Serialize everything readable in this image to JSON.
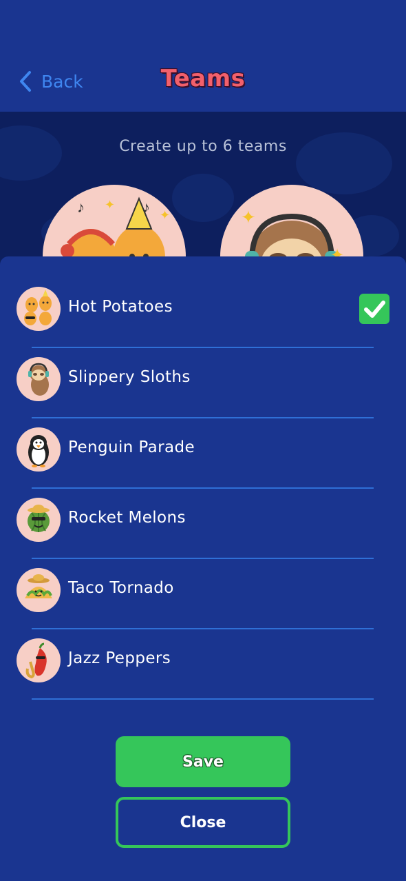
{
  "header": {
    "back_label": "Back",
    "title": "Teams"
  },
  "hero": {
    "subtitle": "Create up to 6 teams"
  },
  "teams": [
    {
      "name": "Hot Potatoes",
      "icon": "potato-icon",
      "selected": true
    },
    {
      "name": "Slippery Sloths",
      "icon": "sloth-icon",
      "selected": false
    },
    {
      "name": "Penguin Parade",
      "icon": "penguin-icon",
      "selected": false
    },
    {
      "name": "Rocket Melons",
      "icon": "melon-icon",
      "selected": false
    },
    {
      "name": "Taco Tornado",
      "icon": "taco-icon",
      "selected": false
    },
    {
      "name": "Jazz Peppers",
      "icon": "pepper-icon",
      "selected": false
    }
  ],
  "actions": {
    "save_label": "Save",
    "close_label": "Close"
  },
  "colors": {
    "background": "#1a3590",
    "hero_background": "#0d1f5e",
    "accent_green": "#35c65a",
    "title_red": "#f2606c",
    "back_blue": "#3f86f0",
    "divider_blue": "#2f6fd6",
    "avatar_bg": "#f7cfc6"
  }
}
